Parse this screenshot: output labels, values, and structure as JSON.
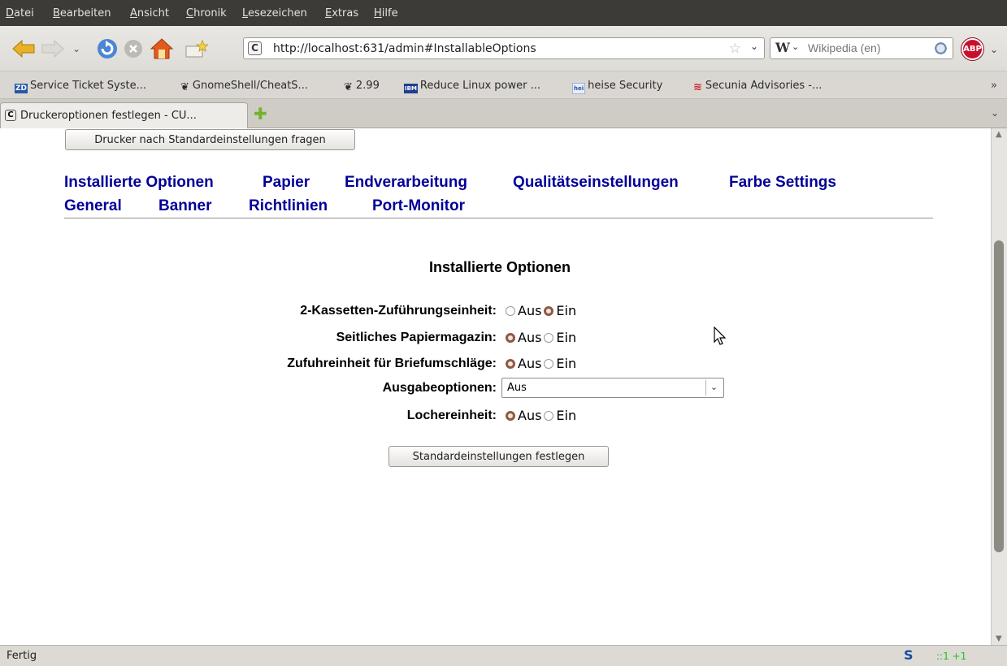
{
  "menubar": {
    "items": [
      "Datei",
      "Bearbeiten",
      "Ansicht",
      "Chronik",
      "Lesezeichen",
      "Extras",
      "Hilfe"
    ]
  },
  "navbar": {
    "back_icon": "back-arrow-icon",
    "forward_icon": "forward-arrow-icon",
    "reload_icon": "reload-icon",
    "stop_icon": "stop-icon",
    "home_icon": "home-icon",
    "url": "http://localhost:631/admin#InstallableOptions",
    "search_placeholder": "Wikipedia (en)",
    "abp_label": "ABP"
  },
  "bookmarks": {
    "items": [
      {
        "icon": "ZD",
        "label": "Service Ticket Syste..."
      },
      {
        "icon": "❦",
        "label": "GnomeShell/CheatS..."
      },
      {
        "icon": "❦",
        "label": "2.99"
      },
      {
        "icon": "IBM",
        "label": "Reduce Linux power ..."
      },
      {
        "icon": "hei",
        "label": "heise Security"
      },
      {
        "icon": "≋",
        "label": "Secunia Advisories -..."
      }
    ],
    "overflow": "»"
  },
  "tabs": {
    "active_title": "Druckeroptionen festlegen - CU...",
    "new_tab": "✚",
    "list_button": "⌄"
  },
  "page": {
    "query_button": "Drucker nach Standardeinstellungen fragen",
    "nav_row1": [
      "Installierte Optionen",
      "Papier",
      "Endverarbeitung",
      "Qualitätseinstellungen",
      "Farbe Settings"
    ],
    "nav_row2": [
      "General",
      "Banner",
      "Richtlinien",
      "Port-Monitor"
    ],
    "section_title": "Installierte Optionen",
    "options": [
      {
        "label": "2-Kassetten-Zuführungseinheit:",
        "selected": "Ein",
        "choices": [
          "Aus",
          "Ein"
        ]
      },
      {
        "label": "Seitliches Papiermagazin:",
        "selected": "Aus",
        "choices": [
          "Aus",
          "Ein"
        ]
      },
      {
        "label": "Zufuhreinheit für Briefumschläge:",
        "selected": "Aus",
        "choices": [
          "Aus",
          "Ein"
        ]
      },
      {
        "label": "Ausgabeoptionen:",
        "select_value": "Aus"
      },
      {
        "label": "Lochereinheit:",
        "selected": "Aus",
        "choices": [
          "Aus",
          "Ein"
        ]
      }
    ],
    "submit_button": "Standardeinstellungen festlegen"
  },
  "statusbar": {
    "text": "Fertig",
    "s_icon": "S",
    "counter": "::1 +1"
  },
  "colors": {
    "link": "#000099",
    "radio_checked": "#8d5a44",
    "menubar_bg": "#3c3b37"
  }
}
